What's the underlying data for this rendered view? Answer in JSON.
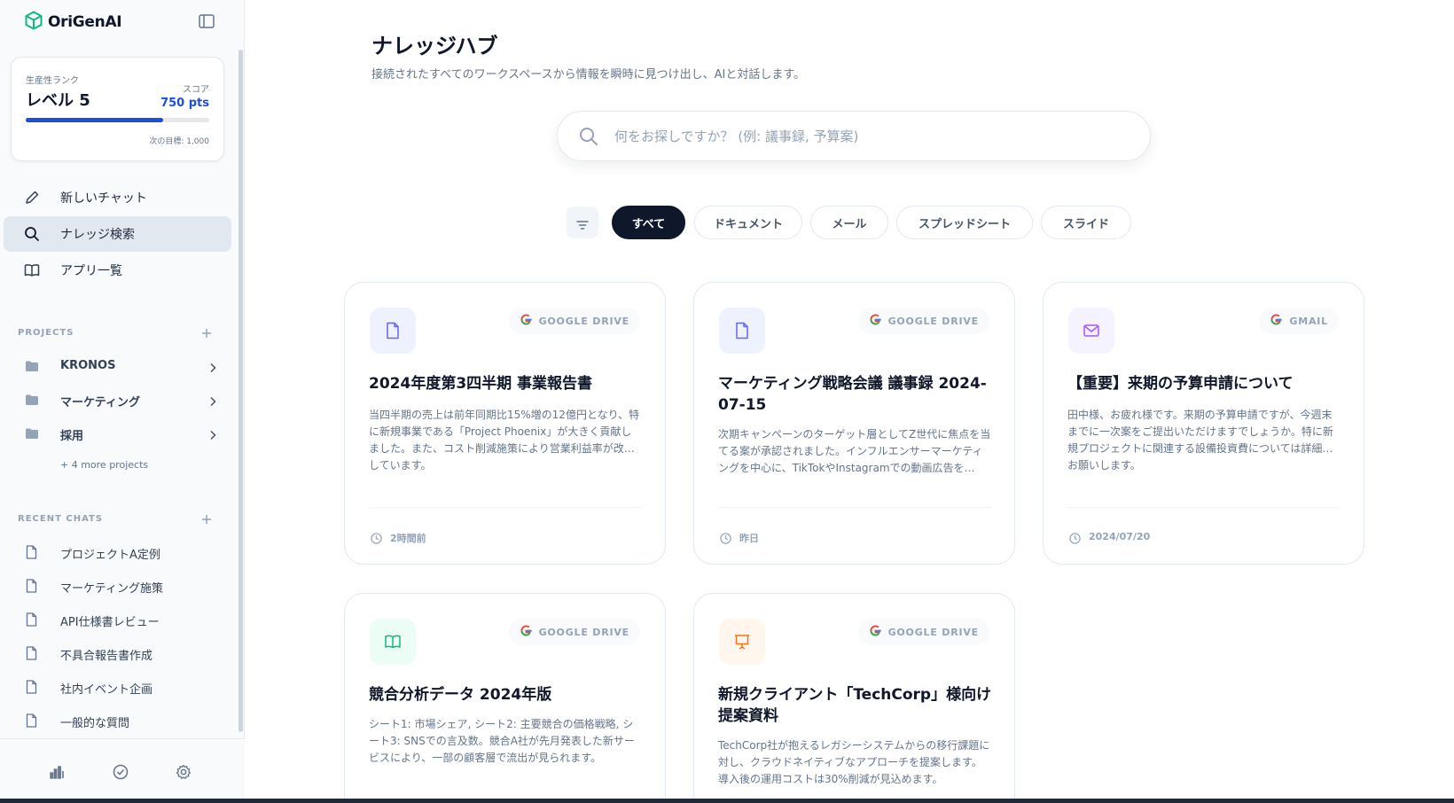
{
  "app": {
    "name": "OriGenAI"
  },
  "rank": {
    "label": "生産性ランク",
    "level": "レベル 5",
    "score_label": "スコア",
    "score": "750 pts",
    "next_goal": "次の目標: 1,000",
    "progress": 0.75
  },
  "nav": [
    {
      "label": "新しいチャット",
      "icon": "pencil-icon"
    },
    {
      "label": "ナレッジ検索",
      "icon": "search-icon",
      "active": true
    },
    {
      "label": "アプリ一覧",
      "icon": "book-icon"
    }
  ],
  "projects": {
    "heading": "PROJECTS",
    "items": [
      {
        "label": "KRONOS"
      },
      {
        "label": "マーケティング"
      },
      {
        "label": "採用"
      }
    ],
    "more": "+ 4 more projects"
  },
  "recent": {
    "heading": "RECENT CHATS",
    "items": [
      {
        "label": "プロジェクトA定例"
      },
      {
        "label": "マーケティング施策"
      },
      {
        "label": "API仕様書レビュー"
      },
      {
        "label": "不具合報告書作成"
      },
      {
        "label": "社内イベント企画"
      },
      {
        "label": "一般的な質問"
      }
    ]
  },
  "main": {
    "title": "ナレッジハブ",
    "subtitle": "接続されたすべてのワークスペースから情報を瞬時に見つけ出し、AIと対話します。",
    "search_placeholder": "何をお探しですか？ (例: 議事録, 予算案)",
    "filters": [
      {
        "label": "すべて",
        "active": true
      },
      {
        "label": "ドキュメント"
      },
      {
        "label": "メール"
      },
      {
        "label": "スプレッドシート"
      },
      {
        "label": "スライド"
      }
    ]
  },
  "cards": [
    {
      "icon": "document-icon",
      "source": "GOOGLE DRIVE",
      "title": "2024年度第3四半期 事業報告書",
      "desc": "当四半期の売上は前年同期比15%増の12億円となり、特に新規事業である「Project Phoenix」が大きく貢献しました。また、コスト削減施策により営業利益率が改…しています。",
      "time": "2時間前"
    },
    {
      "icon": "document-icon",
      "source": "GOOGLE DRIVE",
      "title": "マーケティング戦略会議 議事録 2024-07-15",
      "desc": "次期キャンペーンのターゲット層としてZ世代に焦点を当てる案が承認されました。インフルエンサーマーケティングを中心に、TikTokやInstagramでの動画広告を…",
      "time": "昨日"
    },
    {
      "icon": "mail-icon",
      "source": "GMAIL",
      "title": "【重要】来期の予算申請について",
      "desc": "田中様、お疲れ様です。来期の予算申請ですが、今週末までに一次案をご提出いただけますでしょうか。特に新規プロジェクトに関連する設備投資費については詳細…お願いします。",
      "time": "2024/07/20"
    },
    {
      "icon": "spreadsheet-icon",
      "source": "GOOGLE DRIVE",
      "title": "競合分析データ 2024年版",
      "desc": "シート1: 市場シェア, シート2: 主要競合の価格戦略, シート3: SNSでの言及数。競合A社が先月発表した新サービスにより、一部の顧客層で流出が見られます。",
      "time": ""
    },
    {
      "icon": "presentation-icon",
      "source": "GOOGLE DRIVE",
      "title": "新規クライアント「TechCorp」様向け提案資料",
      "desc": "TechCorp社が抱えるレガシーシステムからの移行課題に対し、クラウドネイティブなアプローチを提案します。導入後の運用コストは30%削減が見込めます。",
      "time": ""
    }
  ],
  "colors": {
    "accent": "#1d4ed8",
    "dark": "#0f172a",
    "brand_green": "#10b981"
  }
}
